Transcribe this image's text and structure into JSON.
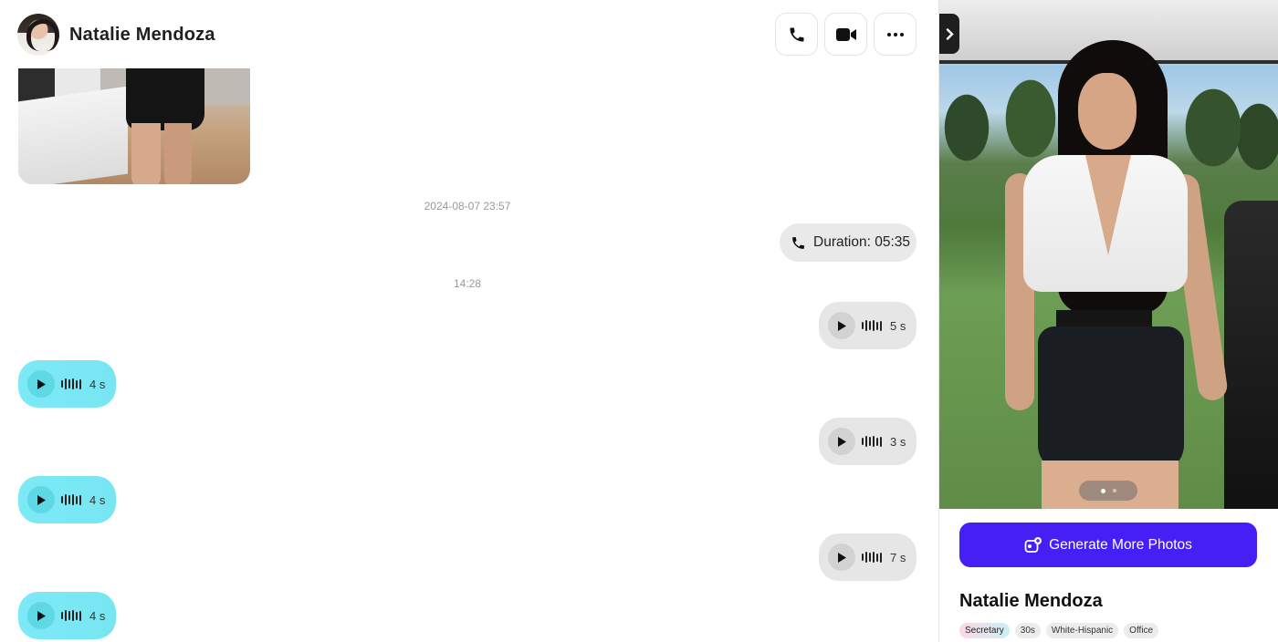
{
  "header": {
    "contact_name": "Natalie Mendoza",
    "avatar_icon": "avatar-portrait",
    "actions": [
      {
        "icon": "phone-icon"
      },
      {
        "icon": "video-camera-icon"
      },
      {
        "icon": "more-horizontal-icon"
      }
    ]
  },
  "messages": {
    "timestamp_1": "2024-08-07 23:57",
    "call_duration": "Duration: 05:35",
    "timestamp_2": "14:28",
    "voice": [
      {
        "side": "outgoing",
        "duration": "5 s"
      },
      {
        "side": "incoming",
        "duration": "4 s"
      },
      {
        "side": "outgoing",
        "duration": "3 s"
      },
      {
        "side": "incoming",
        "duration": "4 s"
      },
      {
        "side": "outgoing",
        "duration": "7 s"
      },
      {
        "side": "incoming",
        "duration": "4 s"
      }
    ]
  },
  "panel": {
    "collapse_icon": "chevron-right-icon",
    "carousel": {
      "count": 2,
      "active": 1
    },
    "generate_button": "Generate More Photos",
    "generate_icon": "add-photo-icon",
    "profile_name": "Natalie Mendoza",
    "tags": [
      "Secretary",
      "30s",
      "White-Hispanic",
      "Office"
    ]
  },
  "colors": {
    "accent": "#4420f5",
    "incoming_bubble": "#78e6f2",
    "outgoing_bubble": "#e6e6e6"
  }
}
